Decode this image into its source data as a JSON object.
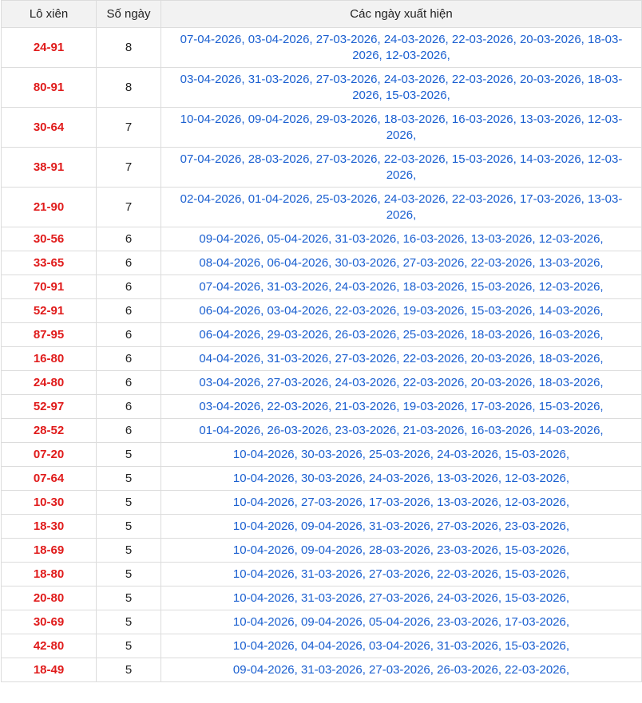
{
  "headers": {
    "pair": "Lô xiên",
    "count": "Số ngày",
    "dates": "Các ngày xuất hiện"
  },
  "rows": [
    {
      "pair": "24-91",
      "count": "8",
      "dates": "07-04-2026, 03-04-2026, 27-03-2026, 24-03-2026, 22-03-2026, 20-03-2026, 18-03-2026, 12-03-2026,"
    },
    {
      "pair": "80-91",
      "count": "8",
      "dates": "03-04-2026, 31-03-2026, 27-03-2026, 24-03-2026, 22-03-2026, 20-03-2026, 18-03-2026, 15-03-2026,"
    },
    {
      "pair": "30-64",
      "count": "7",
      "dates": "10-04-2026, 09-04-2026, 29-03-2026, 18-03-2026, 16-03-2026, 13-03-2026, 12-03-2026,"
    },
    {
      "pair": "38-91",
      "count": "7",
      "dates": "07-04-2026, 28-03-2026, 27-03-2026, 22-03-2026, 15-03-2026, 14-03-2026, 12-03-2026,"
    },
    {
      "pair": "21-90",
      "count": "7",
      "dates": "02-04-2026, 01-04-2026, 25-03-2026, 24-03-2026, 22-03-2026, 17-03-2026, 13-03-2026,"
    },
    {
      "pair": "30-56",
      "count": "6",
      "dates": "09-04-2026, 05-04-2026, 31-03-2026, 16-03-2026, 13-03-2026, 12-03-2026,"
    },
    {
      "pair": "33-65",
      "count": "6",
      "dates": "08-04-2026, 06-04-2026, 30-03-2026, 27-03-2026, 22-03-2026, 13-03-2026,"
    },
    {
      "pair": "70-91",
      "count": "6",
      "dates": "07-04-2026, 31-03-2026, 24-03-2026, 18-03-2026, 15-03-2026, 12-03-2026,"
    },
    {
      "pair": "52-91",
      "count": "6",
      "dates": "06-04-2026, 03-04-2026, 22-03-2026, 19-03-2026, 15-03-2026, 14-03-2026,"
    },
    {
      "pair": "87-95",
      "count": "6",
      "dates": "06-04-2026, 29-03-2026, 26-03-2026, 25-03-2026, 18-03-2026, 16-03-2026,"
    },
    {
      "pair": "16-80",
      "count": "6",
      "dates": "04-04-2026, 31-03-2026, 27-03-2026, 22-03-2026, 20-03-2026, 18-03-2026,"
    },
    {
      "pair": "24-80",
      "count": "6",
      "dates": "03-04-2026, 27-03-2026, 24-03-2026, 22-03-2026, 20-03-2026, 18-03-2026,"
    },
    {
      "pair": "52-97",
      "count": "6",
      "dates": "03-04-2026, 22-03-2026, 21-03-2026, 19-03-2026, 17-03-2026, 15-03-2026,"
    },
    {
      "pair": "28-52",
      "count": "6",
      "dates": "01-04-2026, 26-03-2026, 23-03-2026, 21-03-2026, 16-03-2026, 14-03-2026,"
    },
    {
      "pair": "07-20",
      "count": "5",
      "dates": "10-04-2026, 30-03-2026, 25-03-2026, 24-03-2026, 15-03-2026,"
    },
    {
      "pair": "07-64",
      "count": "5",
      "dates": "10-04-2026, 30-03-2026, 24-03-2026, 13-03-2026, 12-03-2026,"
    },
    {
      "pair": "10-30",
      "count": "5",
      "dates": "10-04-2026, 27-03-2026, 17-03-2026, 13-03-2026, 12-03-2026,"
    },
    {
      "pair": "18-30",
      "count": "5",
      "dates": "10-04-2026, 09-04-2026, 31-03-2026, 27-03-2026, 23-03-2026,"
    },
    {
      "pair": "18-69",
      "count": "5",
      "dates": "10-04-2026, 09-04-2026, 28-03-2026, 23-03-2026, 15-03-2026,"
    },
    {
      "pair": "18-80",
      "count": "5",
      "dates": "10-04-2026, 31-03-2026, 27-03-2026, 22-03-2026, 15-03-2026,"
    },
    {
      "pair": "20-80",
      "count": "5",
      "dates": "10-04-2026, 31-03-2026, 27-03-2026, 24-03-2026, 15-03-2026,"
    },
    {
      "pair": "30-69",
      "count": "5",
      "dates": "10-04-2026, 09-04-2026, 05-04-2026, 23-03-2026, 17-03-2026,"
    },
    {
      "pair": "42-80",
      "count": "5",
      "dates": "10-04-2026, 04-04-2026, 03-04-2026, 31-03-2026, 15-03-2026,"
    },
    {
      "pair": "18-49",
      "count": "5",
      "dates": "09-04-2026, 31-03-2026, 27-03-2026, 26-03-2026, 22-03-2026,"
    }
  ]
}
